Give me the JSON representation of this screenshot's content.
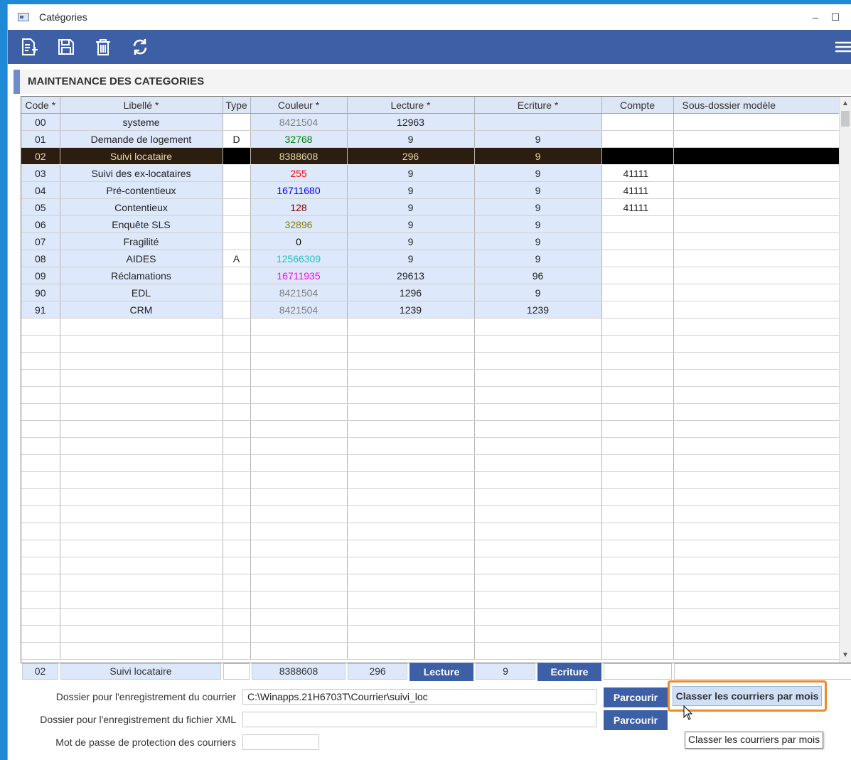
{
  "window": {
    "title": "Catégories",
    "minimize_glyph": "–",
    "maximize_glyph": "☐"
  },
  "toolbar": {
    "icons": [
      "new-document-icon",
      "save-icon",
      "delete-icon",
      "refresh-icon",
      "menu-icon"
    ]
  },
  "panel": {
    "title": "MAINTENANCE DES CATEGORIES"
  },
  "grid": {
    "columns": [
      "Code *",
      "Libellé *",
      "Type",
      "Couleur *",
      "Lecture *",
      "Ecriture *",
      "Compte",
      "Sous-dossier modèle"
    ],
    "rows": [
      {
        "code": "00",
        "libelle": "systeme",
        "type": "",
        "couleur": "8421504",
        "couleur_hex": "#808080",
        "lecture": "12963",
        "ecriture": "",
        "compte": "",
        "sous_dossier": ""
      },
      {
        "code": "01",
        "libelle": "Demande de logement",
        "type": "D",
        "couleur": "32768",
        "couleur_hex": "#008000",
        "lecture": "9",
        "ecriture": "9",
        "compte": "",
        "sous_dossier": ""
      },
      {
        "code": "02",
        "libelle": "Suivi locataire",
        "type": "",
        "couleur": "8388608",
        "couleur_hex": "#e8d9a8",
        "lecture": "296",
        "ecriture": "9",
        "compte": "",
        "sous_dossier": ""
      },
      {
        "code": "03",
        "libelle": "Suivi des ex-locataires",
        "type": "",
        "couleur": "255",
        "couleur_hex": "#ff0000",
        "lecture": "9",
        "ecriture": "9",
        "compte": "41111",
        "sous_dossier": ""
      },
      {
        "code": "04",
        "libelle": "Pré-contentieux",
        "type": "",
        "couleur": "16711680",
        "couleur_hex": "#0000ff",
        "lecture": "9",
        "ecriture": "9",
        "compte": "41111",
        "sous_dossier": ""
      },
      {
        "code": "05",
        "libelle": "Contentieux",
        "type": "",
        "couleur": "128",
        "couleur_hex": "#800000",
        "lecture": "9",
        "ecriture": "9",
        "compte": "41111",
        "sous_dossier": ""
      },
      {
        "code": "06",
        "libelle": "Enquête SLS",
        "type": "",
        "couleur": "32896",
        "couleur_hex": "#808000",
        "lecture": "9",
        "ecriture": "9",
        "compte": "",
        "sous_dossier": ""
      },
      {
        "code": "07",
        "libelle": "Fragilité",
        "type": "",
        "couleur": "0",
        "couleur_hex": "#000000",
        "lecture": "9",
        "ecriture": "9",
        "compte": "",
        "sous_dossier": ""
      },
      {
        "code": "08",
        "libelle": "AIDES",
        "type": "A",
        "couleur": "12566309",
        "couleur_hex": "#25bfbf",
        "lecture": "9",
        "ecriture": "9",
        "compte": "",
        "sous_dossier": ""
      },
      {
        "code": "09",
        "libelle": "Réclamations",
        "type": "",
        "couleur": "16711935",
        "couleur_hex": "#ff00ff",
        "lecture": "29613",
        "ecriture": "96",
        "compte": "",
        "sous_dossier": ""
      },
      {
        "code": "90",
        "libelle": "EDL",
        "type": "",
        "couleur": "8421504",
        "couleur_hex": "#808080",
        "lecture": "1296",
        "ecriture": "9",
        "compte": "",
        "sous_dossier": ""
      },
      {
        "code": "91",
        "libelle": "CRM",
        "type": "",
        "couleur": "8421504",
        "couleur_hex": "#808080",
        "lecture": "1239",
        "ecriture": "1239",
        "compte": "",
        "sous_dossier": ""
      }
    ]
  },
  "edit": {
    "code": "02",
    "libelle": "Suivi locataire",
    "couleur": "8388608",
    "lecture": "296",
    "lecture_btn": "Lecture",
    "ecriture": "9",
    "ecriture_btn": "Ecriture"
  },
  "form": {
    "courrier_label": "Dossier pour l'enregistrement du courrier",
    "courrier_value": "C:\\Winapps.21H6703T\\Courrier\\suivi_loc",
    "xml_label": "Dossier pour l'enregistrement du fichier XML",
    "xml_value": "",
    "password_label": "Mot de passe de protection des courriers",
    "password_value": "",
    "browse_label": "Parcourir",
    "classer_label": "Classer les courriers par mois",
    "tooltip": "Classer les courriers par mois"
  },
  "colors": {
    "toolbar": "#3d5fa5",
    "accent_orange": "#f08a24",
    "row_fill": "#dde8fb"
  }
}
